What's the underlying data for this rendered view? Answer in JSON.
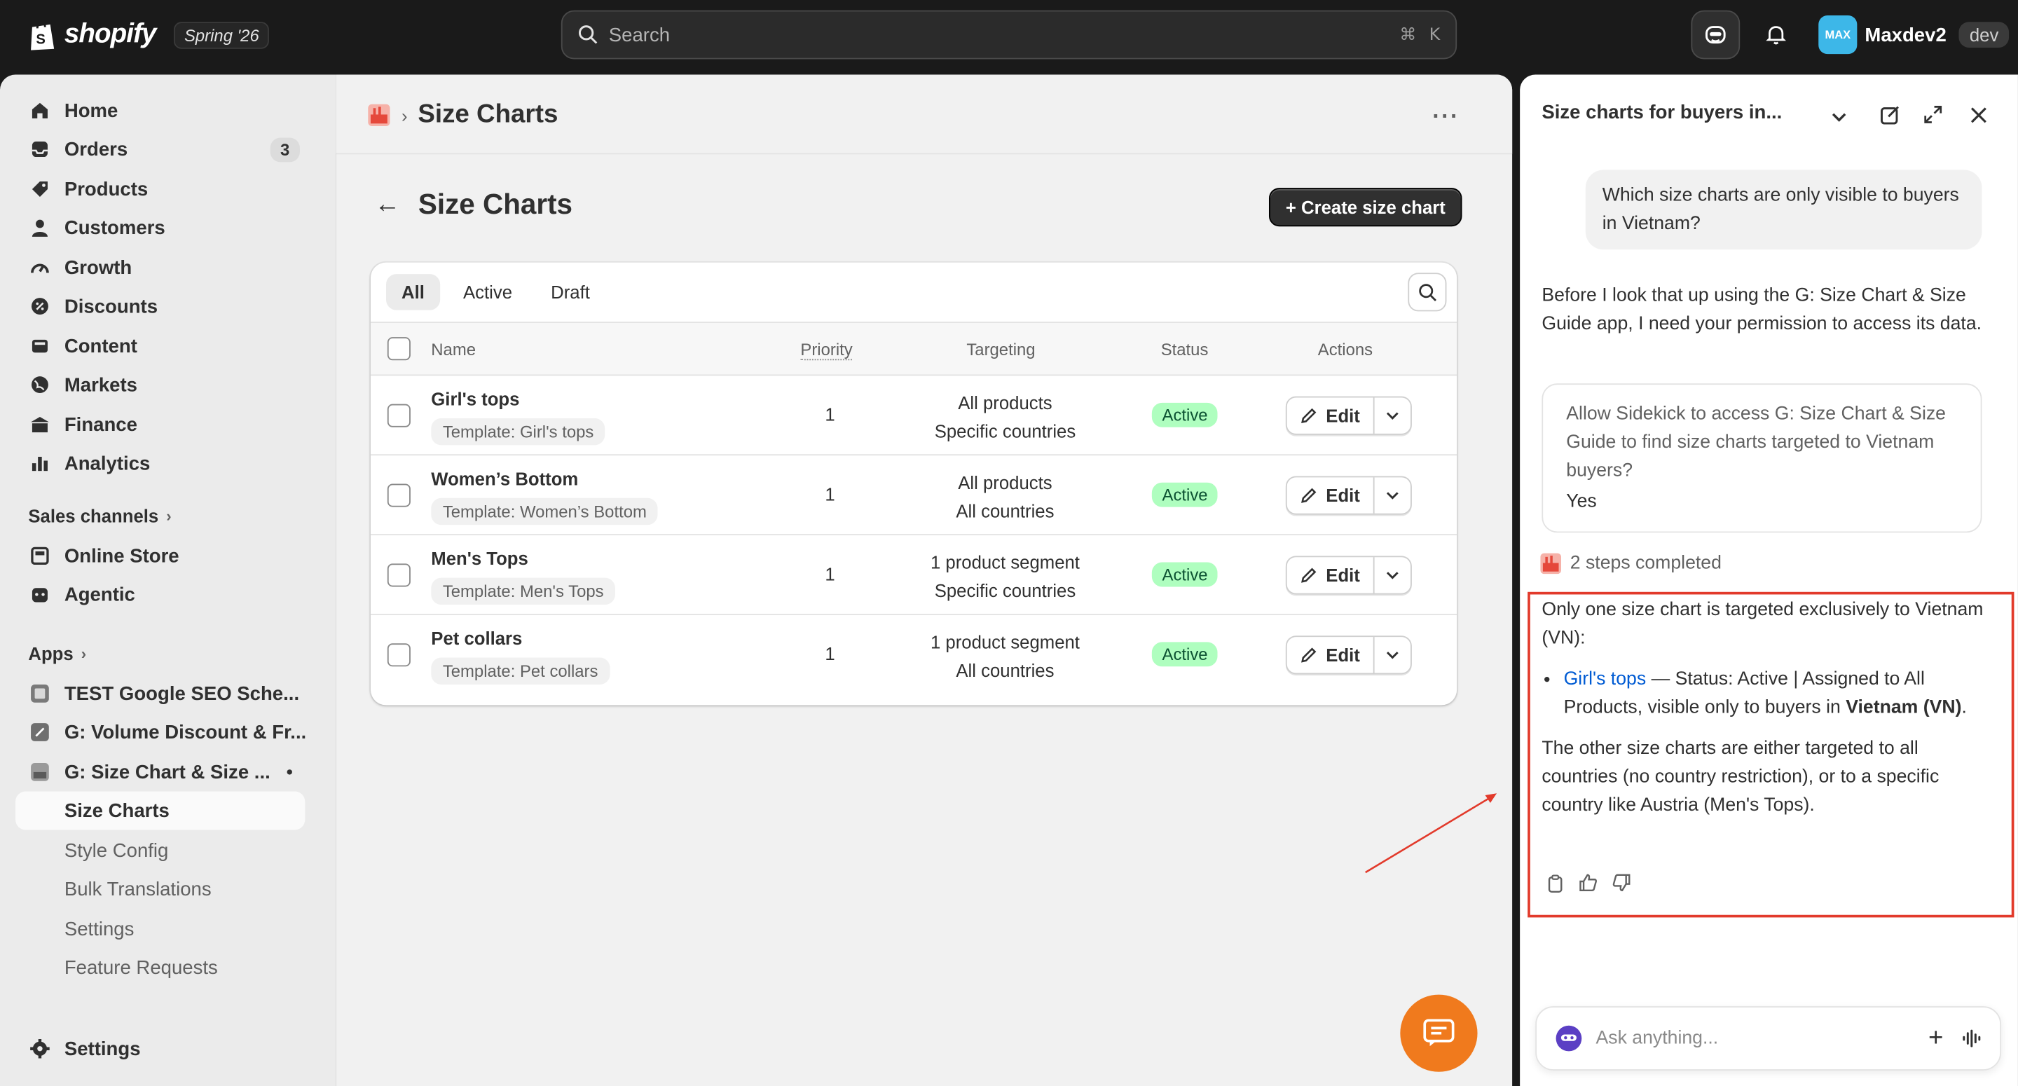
{
  "topbar": {
    "brand": "shopify",
    "edition": "Spring '26",
    "search_placeholder": "Search",
    "shortcut_cmd": "⌘",
    "shortcut_key": "K",
    "user_avatar": "MAX",
    "user_name": "Maxdev2",
    "user_tag": "dev"
  },
  "sidebar": {
    "items": [
      {
        "label": "Home",
        "icon": "home-icon"
      },
      {
        "label": "Orders",
        "icon": "orders-icon",
        "badge": "3"
      },
      {
        "label": "Products",
        "icon": "tag-icon"
      },
      {
        "label": "Customers",
        "icon": "person-icon"
      },
      {
        "label": "Growth",
        "icon": "gauge-icon"
      },
      {
        "label": "Discounts",
        "icon": "discount-icon"
      },
      {
        "label": "Content",
        "icon": "content-icon"
      },
      {
        "label": "Markets",
        "icon": "globe-icon"
      },
      {
        "label": "Finance",
        "icon": "bank-icon"
      },
      {
        "label": "Analytics",
        "icon": "bar-chart-icon"
      }
    ],
    "sales_channels_title": "Sales channels",
    "channels": [
      {
        "label": "Online Store",
        "icon": "store-icon"
      },
      {
        "label": "Agentic",
        "icon": "robot-icon"
      }
    ],
    "apps_title": "Apps",
    "apps": [
      {
        "label": "TEST Google SEO Sche..."
      },
      {
        "label": "G: Volume Discount & Fr..."
      },
      {
        "label": "G: Size Chart & Size ..."
      }
    ],
    "app_subitems": [
      {
        "label": "Size Charts"
      },
      {
        "label": "Style Config"
      },
      {
        "label": "Bulk Translations"
      },
      {
        "label": "Settings"
      },
      {
        "label": "Feature Requests"
      }
    ],
    "settings_label": "Settings"
  },
  "main": {
    "breadcrumb_title": "Size Charts",
    "page_title": "Size Charts",
    "create_button": "+ Create size chart",
    "tabs": [
      "All",
      "Active",
      "Draft"
    ],
    "columns": {
      "name": "Name",
      "priority": "Priority",
      "targeting": "Targeting",
      "status": "Status",
      "actions": "Actions"
    },
    "rows": [
      {
        "name": "Girl's tops",
        "template": "Template: Girl's tops",
        "priority": "1",
        "target1": "All products",
        "target2": "Specific countries",
        "status": "Active",
        "edit": "Edit"
      },
      {
        "name": "Women’s Bottom",
        "template": "Template: Women’s Bottom",
        "priority": "1",
        "target1": "All products",
        "target2": "All countries",
        "status": "Active",
        "edit": "Edit"
      },
      {
        "name": "Men's Tops",
        "template": "Template: Men's Tops",
        "priority": "1",
        "target1": "1 product segment",
        "target2": "Specific countries",
        "status": "Active",
        "edit": "Edit"
      },
      {
        "name": "Pet collars",
        "template": "Template: Pet collars",
        "priority": "1",
        "target1": "1 product segment",
        "target2": "All countries",
        "status": "Active",
        "edit": "Edit"
      }
    ]
  },
  "sidekick": {
    "title": "Size charts for buyers in...",
    "user_message": "Which size charts are only visible to buyers in Vietnam?",
    "ai_intro": "Before I look that up using the G: Size Chart & Size Guide app, I need your permission to access its data.",
    "permission_question": "Allow Sidekick to access G: Size Chart & Size Guide to find size charts targeted to Vietnam buyers?",
    "permission_answer": "Yes",
    "steps_label": "2 steps completed",
    "answer_p1": "Only one size chart is targeted exclusively to Vietnam (VN):",
    "answer_link": "Girl's tops",
    "answer_li_mid": " — Status: Active | Assigned to All Products, visible only to buyers in ",
    "answer_li_bold": "Vietnam (VN)",
    "answer_li_end": ".",
    "answer_p2": "The other size charts are either targeted to all countries (no country restriction), or to a specific country like Austria (Men's Tops).",
    "ask_placeholder": "Ask anything..."
  },
  "colors": {
    "accent_orange": "#f07a1d",
    "status_green_bg": "#affebf",
    "highlight_red": "#e23a2b",
    "link_blue": "#005bd3"
  }
}
